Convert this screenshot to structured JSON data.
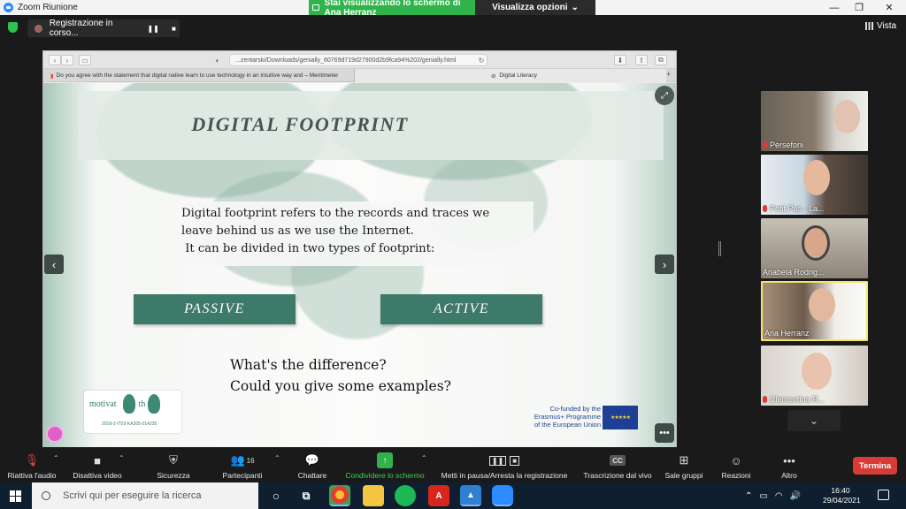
{
  "window": {
    "title": "Zoom Riunione"
  },
  "share_banner": {
    "text": "Stai visualizzando lo schermo di Ana Herranz",
    "view_options": "Visualizza opzioni"
  },
  "recording": {
    "label": "Registrazione in corso..."
  },
  "view": {
    "label": "Vista"
  },
  "browser": {
    "url": "...zentarski/Downloads/genially_60769d719d27900d2b9fca94%202/genially.html",
    "tabs": [
      "Do you agree with the statement that digital native learn to use technology in an intuitive way and – Mentimeter",
      "Digital Literacy"
    ]
  },
  "slide": {
    "title": "DIGITAL FOOTPRINT",
    "definition": [
      "Digital footprint refers to the records and traces we",
      "leave behind us as we use the Internet.",
      " It can be divided in two types of footprint:"
    ],
    "types": {
      "passive": "PASSIVE",
      "active": "ACTIVE"
    },
    "questions": [
      "What's the difference?",
      "Could you give some examples?"
    ],
    "logo": {
      "text": "motivat   yo   th",
      "code": "2018-2-IT03-KA205-014235"
    },
    "eu": {
      "text": [
        "Co-funded by the",
        "Erasmus+ Programme",
        "of the European Union"
      ]
    }
  },
  "participants": [
    {
      "name": "Persefoni",
      "muted": true
    },
    {
      "name": "Petit Pas - La...",
      "muted": true
    },
    {
      "name": "Anabela Rodrig...",
      "muted": false
    },
    {
      "name": "Ana Herranz",
      "muted": false,
      "active": true
    },
    {
      "name": "Clementina R...",
      "muted": true
    }
  ],
  "toolbar": {
    "unmute": "Riattiva l'audio",
    "stop_video": "Disattiva video",
    "security": "Sicurezza",
    "participants": "Partecipanti",
    "participants_count": "16",
    "chat": "Chattare",
    "share": "Condividere lo schermo",
    "pause_rec": "Metti in pausa/Arresta la registrazione",
    "transcript": "Trascrizione dal vivo",
    "breakout": "Sale gruppi",
    "reactions": "Reazioni",
    "more": "Altro",
    "end": "Termina",
    "cc": "CC"
  },
  "taskbar": {
    "search_placeholder": "Scrivi qui per eseguire la ricerca",
    "time": "16:40",
    "date": "29/04/2021"
  },
  "colors": {
    "accent_green": "#31b34b",
    "slide_teal": "#3d7a6a",
    "end_red": "#d63b35"
  }
}
